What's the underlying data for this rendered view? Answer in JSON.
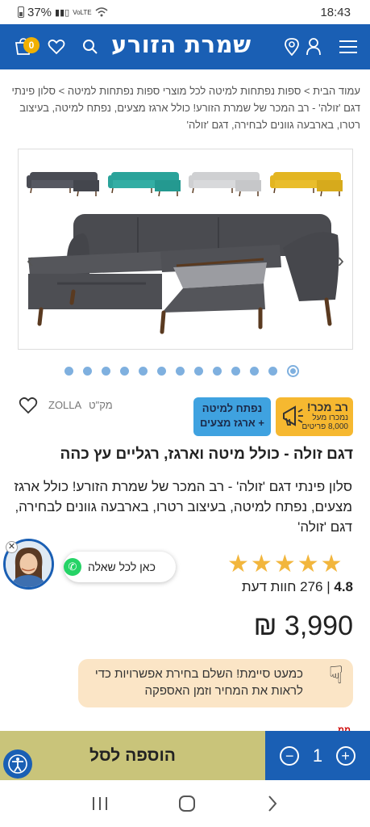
{
  "status_bar": {
    "battery_percent": "37%",
    "network": "VoLTE",
    "time": "18:43"
  },
  "header": {
    "logo_text": "שמרת הזורע",
    "cart_count": "0",
    "brand_color": "#1a5fb4",
    "icons": [
      "menu-icon",
      "user-icon",
      "location-icon",
      "search-icon",
      "heart-icon",
      "cart-icon"
    ]
  },
  "breadcrumb": {
    "text": "עמוד הבית > ספות נפתחות למיטה לכל מוצרי ספות נפתחות למיטה > סלון פינתי דגם 'זולה' - רב המכר של שמרת הזורע! כולל ארגז מצעים, נפתח למיטה, בעיצוב רטרו, בארבעה גוונים לבחירה, דגם 'זולה'"
  },
  "gallery": {
    "thumbnail_colors": [
      "#4a4c54",
      "#2aa39a",
      "#cfd0d2",
      "#e3b521"
    ],
    "main_sofa_color": "#4a4b50",
    "dot_count": 13,
    "active_dot": 13
  },
  "badges": {
    "sale_title": "רב מכר!",
    "sale_sub1": "נמכרו מעל",
    "sale_sub2": "8,000 פריטים",
    "feature_line1": "נפתח למיטה",
    "feature_line2": "+ ארגז מצעים"
  },
  "sku": {
    "label": "מק\"ט",
    "value": "ZOLLA"
  },
  "product": {
    "title": "דגם זולה - כולל מיטה וארגז, רגליים עץ כהה",
    "description": "סלון פינתי דגם 'זולה' - רב המכר של שמרת הזורע! כולל ארגז מצעים, נפתח למיטה, בעיצוב רטרו, בארבעה גוונים לבחירה, דגם 'זולה'",
    "rating_value": "4.8",
    "stars": 5,
    "reviews": "276 חוות דעת",
    "price": "3,990 ₪"
  },
  "chat": {
    "label": "כאן לכל שאלה"
  },
  "notice": {
    "text": "כמעט סיימת! השלם בחירת אפשרויות כדי לראות את המחיר וזמן האספקה"
  },
  "cart_bar": {
    "add_label": "הוספה לסל",
    "quantity": "1",
    "minus": "−",
    "plus": "+"
  },
  "partial_text": "ממ"
}
